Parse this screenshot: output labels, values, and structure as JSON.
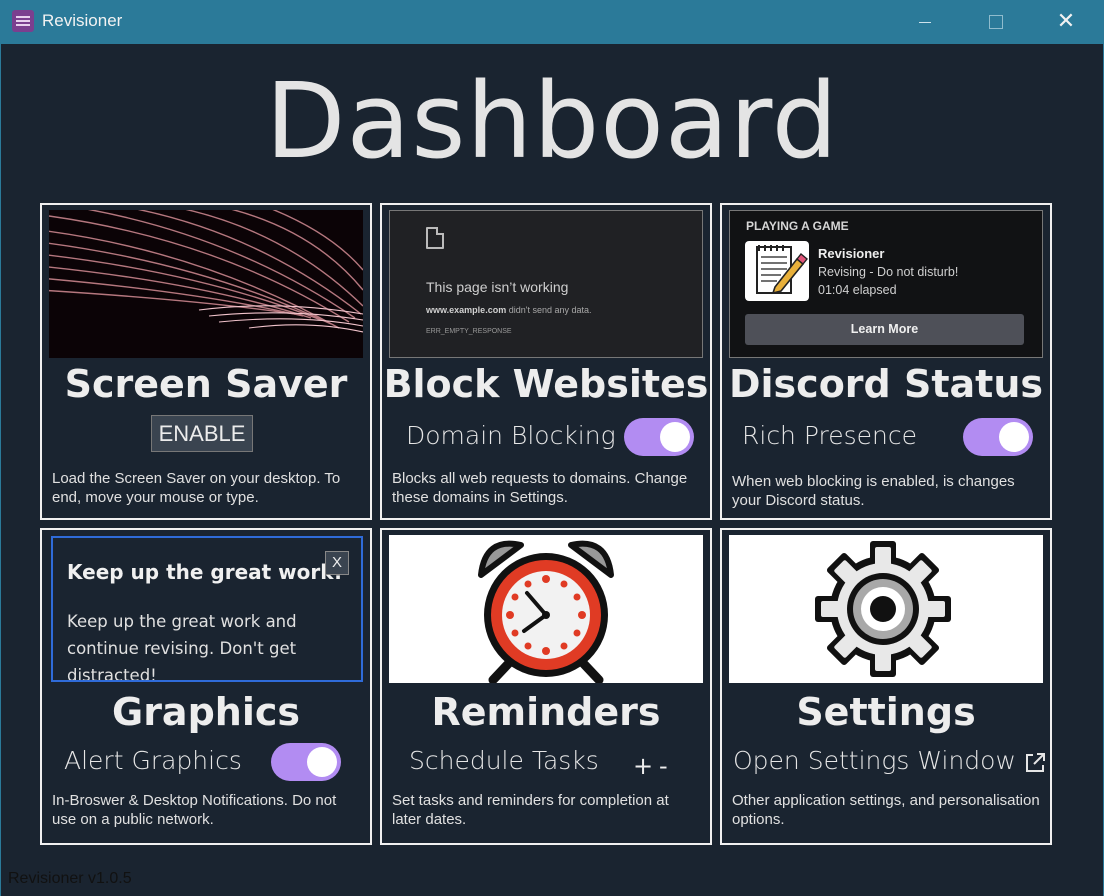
{
  "window": {
    "title": "Revisioner",
    "minimize_icon": "minimize-icon",
    "maximize_icon": "maximize-icon",
    "close_icon": "close-icon",
    "close_glyph": "✕"
  },
  "page_title": "Dashboard",
  "cards": {
    "screen_saver": {
      "title": "Screen Saver",
      "button_label": "ENABLE",
      "description": "Load the Screen Saver on your desktop. To end, move your mouse or type."
    },
    "block_websites": {
      "title": "Block Websites",
      "control_label": "Domain Blocking",
      "toggle_on": true,
      "description": "Blocks all web requests to domains. Change these domains in Settings.",
      "preview": {
        "heading": "This page isn’t working",
        "domain": "www.example.com",
        "message": " didn't send any data.",
        "error_code": "ERR_EMPTY_RESPONSE"
      }
    },
    "discord_status": {
      "title": "Discord Status",
      "control_label": "Rich Presence",
      "toggle_on": true,
      "description": "When web blocking is enabled, is changes your Discord status.",
      "preview": {
        "header": "PLAYING A GAME",
        "app_name": "Revisioner",
        "state": "Revising - Do not disturb!",
        "elapsed": "01:04 elapsed",
        "button": "Learn More"
      }
    },
    "graphics": {
      "title": "Graphics",
      "control_label": "Alert Graphics",
      "toggle_on": true,
      "description": "In-Broswer & Desktop Notifications. Do not use on a public network.",
      "preview": {
        "alert_title": "Keep up the great work!",
        "alert_text": "Keep up the great work and continue revising. Don't get distracted!",
        "close": "X"
      }
    },
    "reminders": {
      "title": "Reminders",
      "control_label": "Schedule Tasks",
      "plus": "+",
      "minus": "-",
      "description": "Set tasks and reminders for completion at later dates."
    },
    "settings": {
      "title": "Settings",
      "control_label": "Open Settings Window",
      "description": "Other application settings, and personalisation options."
    }
  },
  "footer": {
    "version": "Revisioner v1.0.5"
  },
  "colors": {
    "titlebar": "#2b7a99",
    "background": "#1a2430",
    "toggle_accent": "#b28cf2",
    "alert_border": "#2f6bd8"
  }
}
